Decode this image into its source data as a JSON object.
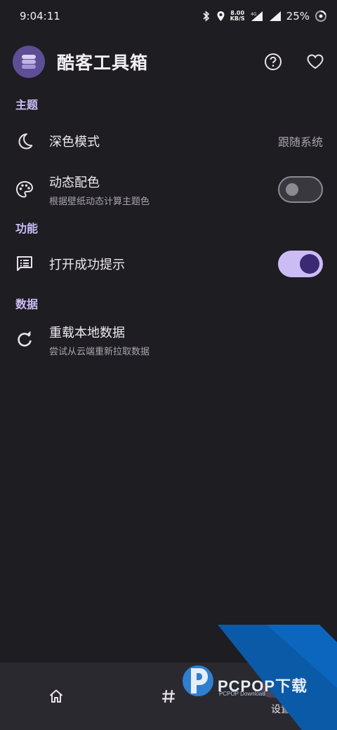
{
  "status_bar": {
    "time": "9:04:11",
    "net_speed_value": "8.00",
    "net_speed_unit": "KB/S",
    "network": "4G",
    "battery": "25%"
  },
  "app_bar": {
    "title": "酷客工具箱",
    "actions": [
      "help-circle-icon",
      "heart-icon"
    ]
  },
  "sections": {
    "theme": {
      "header": "主题",
      "dark_mode": {
        "title": "深色模式",
        "value": "跟随系统"
      },
      "dynamic_color": {
        "title": "动态配色",
        "subtitle": "根据壁纸动态计算主题色",
        "enabled": false
      }
    },
    "features": {
      "header": "功能",
      "open_success_tip": {
        "title": "打开成功提示",
        "enabled": true
      }
    },
    "data": {
      "header": "数据",
      "reload": {
        "title": "重载本地数据",
        "subtitle": "尝试从云端重新拉取数据"
      }
    }
  },
  "bottom_nav": {
    "items": [
      {
        "icon": "home-icon",
        "label": ""
      },
      {
        "icon": "hash-icon",
        "label": ""
      },
      {
        "icon": "settings-icon",
        "label": "设置"
      }
    ]
  },
  "watermark": {
    "text": "PCPOP下载",
    "sub": "PCPOP Download"
  },
  "colors": {
    "accent": "#cbbcf6",
    "background": "#1e1d21",
    "nav": "#2b2930",
    "logo": "#5e4e96"
  }
}
